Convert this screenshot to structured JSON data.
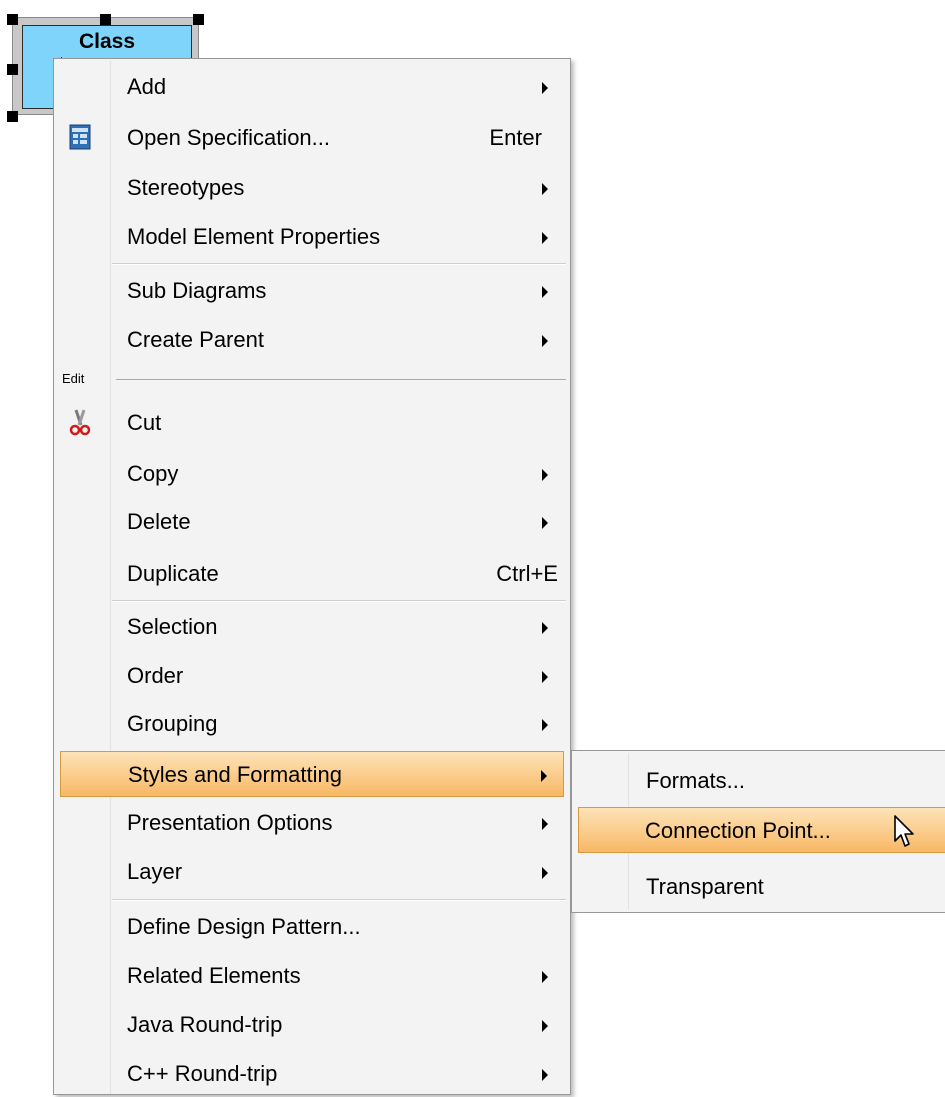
{
  "canvas": {
    "class_shape": {
      "name": "Class"
    }
  },
  "context_menu": {
    "group_edit_label": "Edit",
    "items": [
      {
        "label": "Add",
        "submenu": true
      },
      {
        "label": "Open Specification...",
        "shortcut": "Enter",
        "icon": "specification-icon"
      },
      {
        "label": "Stereotypes",
        "submenu": true
      },
      {
        "label": "Model Element Properties",
        "submenu": true
      },
      {
        "label": "Sub Diagrams",
        "submenu": true
      },
      {
        "label": "Create Parent",
        "submenu": true
      },
      {
        "label": "Cut",
        "icon": "scissors-icon"
      },
      {
        "label": "Copy",
        "submenu": true
      },
      {
        "label": "Delete",
        "submenu": true
      },
      {
        "label": "Duplicate",
        "shortcut": "Ctrl+E"
      },
      {
        "label": "Selection",
        "submenu": true
      },
      {
        "label": "Order",
        "submenu": true
      },
      {
        "label": "Grouping",
        "submenu": true
      },
      {
        "label": "Styles and Formatting",
        "submenu": true,
        "highlighted": true
      },
      {
        "label": "Presentation Options",
        "submenu": true
      },
      {
        "label": "Layer",
        "submenu": true
      },
      {
        "label": "Define Design Pattern..."
      },
      {
        "label": "Related Elements",
        "submenu": true
      },
      {
        "label": "Java Round-trip",
        "submenu": true
      },
      {
        "label": "C++ Round-trip",
        "submenu": true
      }
    ]
  },
  "submenu": {
    "items": [
      {
        "label": "Formats..."
      },
      {
        "label": "Connection Point...",
        "highlighted": true
      },
      {
        "label": "Transparent"
      }
    ]
  },
  "colors": {
    "highlight": "#f8b865",
    "class_fill": "#7fd4fb",
    "menu_background": "#f3f3f3"
  }
}
